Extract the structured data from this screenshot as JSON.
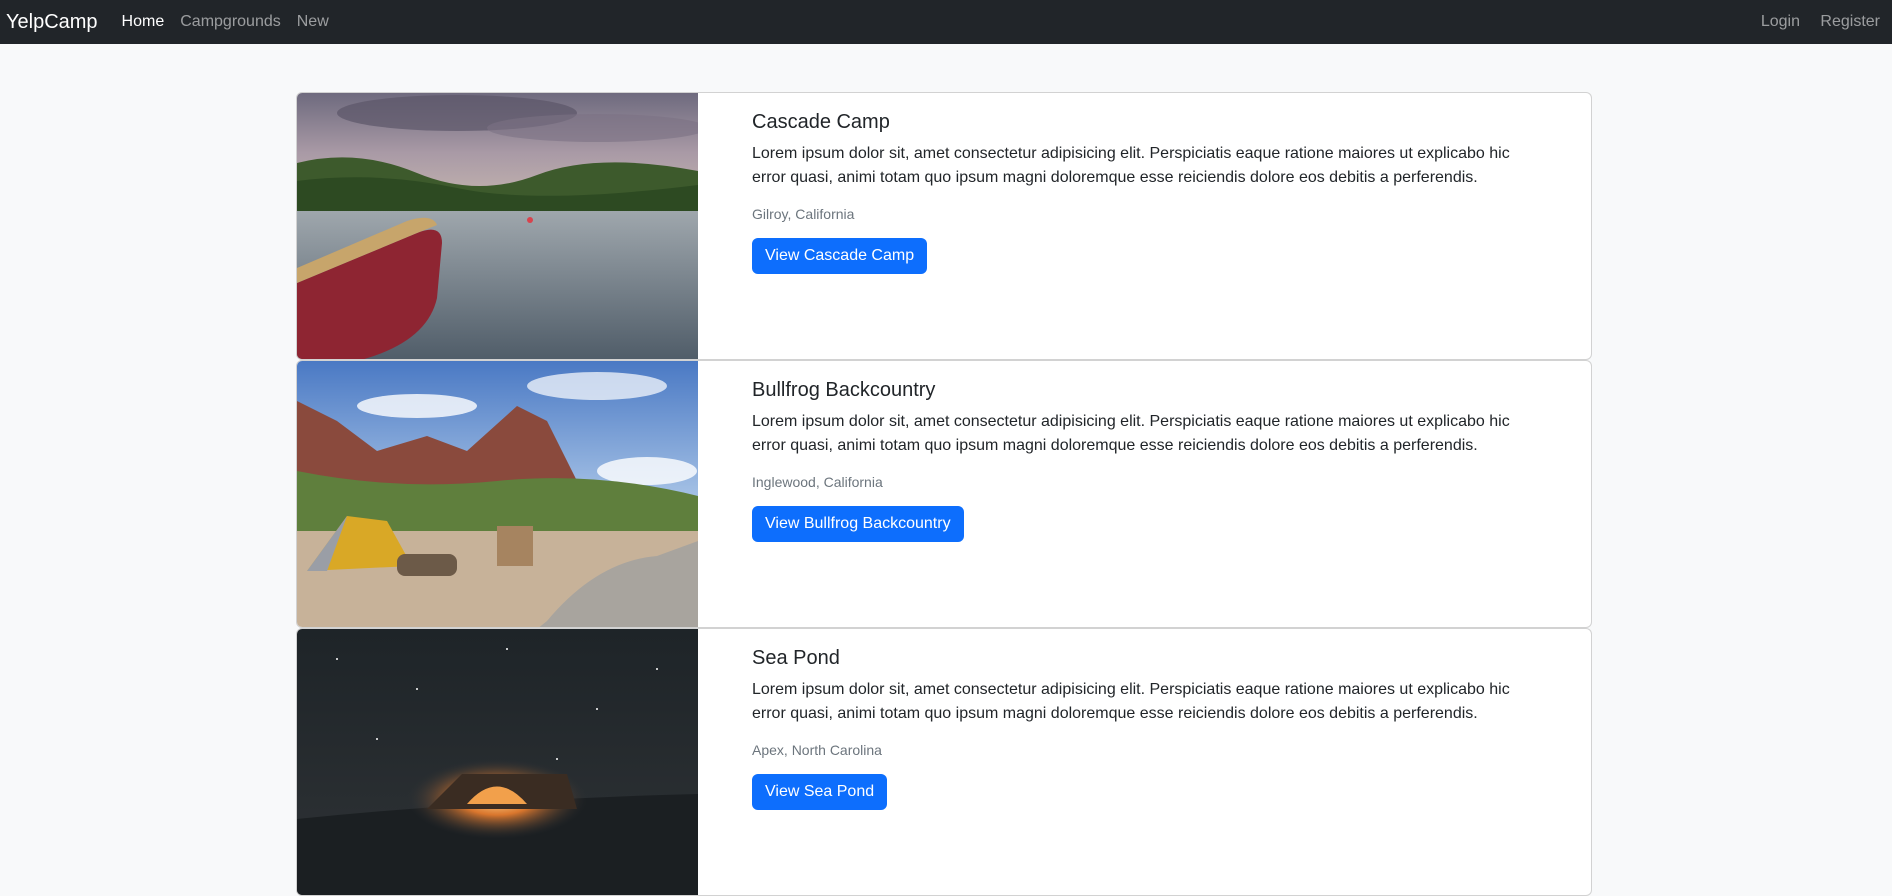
{
  "navbar": {
    "brand": "YelpCamp",
    "links": [
      {
        "label": "Home"
      },
      {
        "label": "Campgrounds"
      },
      {
        "label": "New"
      }
    ],
    "right_links": [
      {
        "label": "Login"
      },
      {
        "label": "Register"
      }
    ]
  },
  "campgrounds": [
    {
      "title": "Cascade Camp",
      "description": "Lorem ipsum dolor sit, amet consectetur adipisicing elit. Perspiciatis eaque ratione maiores ut explicabo hic error quasi, animi totam quo ipsum magni doloremque esse reiciendis dolore eos debitis a perferendis.",
      "location": "Gilroy, California",
      "button": "View Cascade Camp"
    },
    {
      "title": "Bullfrog Backcountry",
      "description": "Lorem ipsum dolor sit, amet consectetur adipisicing elit. Perspiciatis eaque ratione maiores ut explicabo hic error quasi, animi totam quo ipsum magni doloremque esse reiciendis dolore eos debitis a perferendis.",
      "location": "Inglewood, California",
      "button": "View Bullfrog Backcountry"
    },
    {
      "title": "Sea Pond",
      "description": "Lorem ipsum dolor sit, amet consectetur adipisicing elit. Perspiciatis eaque ratione maiores ut explicabo hic error quasi, animi totam quo ipsum magni doloremque esse reiciendis dolore eos debitis a perferendis.",
      "location": "Apex, North Carolina",
      "button": "View Sea Pond"
    }
  ],
  "colors": {
    "navbar_bg": "#212529",
    "primary": "#0d6efd",
    "page_bg": "#f8f9fa"
  }
}
